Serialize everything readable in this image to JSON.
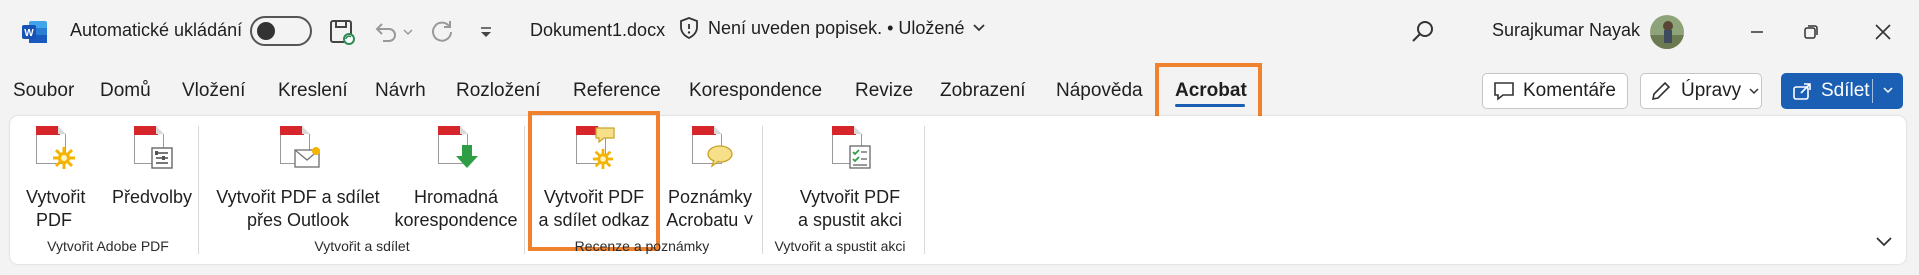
{
  "titlebar": {
    "autosave_label": "Automatické ukládání",
    "doc_name": "Dokument1.docx",
    "doc_status": "Není uveden popisek. • Uložené",
    "user_name": "Surajkumar Nayak"
  },
  "tabs": [
    "Soubor",
    "Domů",
    "Vložení",
    "Kreslení",
    "Návrh",
    "Rozložení",
    "Reference",
    "Korespondence",
    "Revize",
    "Zobrazení",
    "Nápověda",
    "Acrobat"
  ],
  "active_tab": "Acrobat",
  "actions": {
    "comments": "Komentáře",
    "edit": "Úpravy",
    "share": "Sdílet"
  },
  "ribbon": {
    "buttons": {
      "create_pdf": "Vytvořit\nPDF",
      "preferences": "Předvolby",
      "create_share_outlook": "Vytvořit PDF a sdílet\npřes Outlook",
      "mass_correspondence": "Hromadná\nkorespondence",
      "create_share_link": "Vytvořit PDF\na sdílet odkaz",
      "acrobat_notes": "Poznámky\nAcrobatu ˅",
      "create_run_action": "Vytvořit PDF\na spustit akci"
    },
    "groups": {
      "create_adobe_pdf": "Vytvořit Adobe PDF",
      "create_and_share": "Vytvořit a sdílet",
      "review_notes": "Recenze a poznámky",
      "create_run_action": "Vytvořit a spustit akci"
    }
  },
  "colors": {
    "accent_blue": "#1a5fb4",
    "highlight_orange": "#f0822d",
    "pdf_red": "#d7262b"
  }
}
